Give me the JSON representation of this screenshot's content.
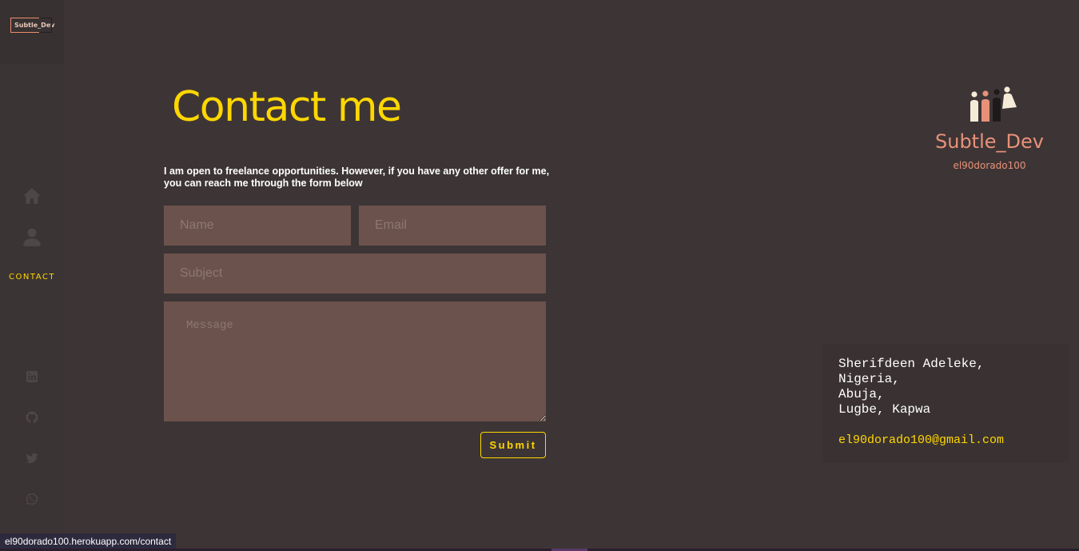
{
  "sidebar": {
    "logo_text": "Subtle_Dev",
    "nav": {
      "home_icon": "home-icon",
      "about_icon": "user-icon",
      "contact_label": "CONTACT"
    },
    "socials": [
      "linkedin-icon",
      "github-icon",
      "twitter-icon",
      "whatsapp-icon"
    ]
  },
  "main": {
    "title": "Contact me",
    "intro": "I am open to freelance opportunities. However, if you have any other offer for me, you can reach me through the form below",
    "form": {
      "name_placeholder": "Name",
      "email_placeholder": "Email",
      "subject_placeholder": "Subject",
      "message_placeholder": "Message",
      "submit_label": "Submit"
    }
  },
  "brand": {
    "name": "Subtle_Dev",
    "handle": "el90dorado100"
  },
  "address": {
    "lines": [
      "Sherifdeen Adeleke,",
      "Nigeria,",
      "Abuja,",
      "Lugbe, Kapwa"
    ],
    "email": "el90dorado100@gmail.com"
  },
  "status_bar": {
    "url": "el90dorado100.herokuapp.com/contact"
  },
  "colors": {
    "background": "#3d3535",
    "accent": "#ffd700",
    "field_bg": "#6b524c",
    "brand": "#e8917a"
  }
}
